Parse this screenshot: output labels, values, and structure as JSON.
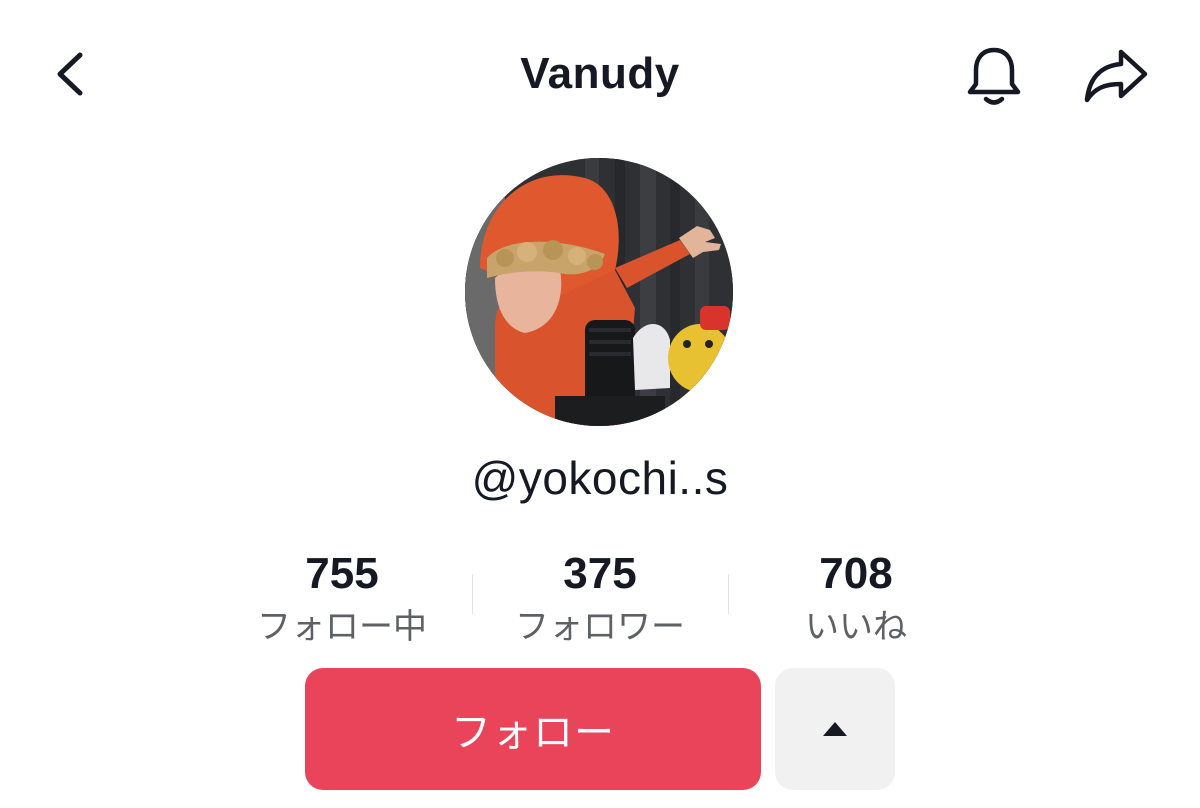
{
  "header": {
    "title": "Vanudy",
    "back_icon": "chevron-left-icon",
    "bell_icon": "bell-icon",
    "share_icon": "share-arrow-icon"
  },
  "profile": {
    "username": "@yokochi..s",
    "avatar": "profile-photo"
  },
  "stats": [
    {
      "value": "755",
      "label": "フォロー中"
    },
    {
      "value": "375",
      "label": "フォロワー"
    },
    {
      "value": "708",
      "label": "いいね"
    }
  ],
  "actions": {
    "follow_label": "フォロー",
    "more_icon": "caret-up-icon"
  },
  "colors": {
    "accent": "#ea445a",
    "text_primary": "#161823",
    "text_secondary": "#5f6066",
    "secondary_button": "#f1f1f2"
  }
}
